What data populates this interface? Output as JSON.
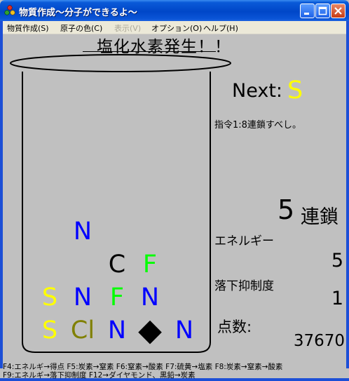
{
  "window": {
    "title": "物質作成～分子ができるよ～"
  },
  "menu": {
    "items": [
      "物質作成(S)",
      "原子の色(C)",
      "表示(V)",
      "オプション(O)",
      "ヘルプ(H)"
    ],
    "disabled_index": 2
  },
  "game": {
    "caption": "塩化水素発生！！",
    "next_label": "Next:",
    "next_atom": "S",
    "order": "指令1:8連鎖すべし。",
    "chain_count": "5",
    "chain_label": "連鎖",
    "energy_label": "エネルギー",
    "energy_value": "5",
    "drop_label": "落下抑制度",
    "drop_value": "1",
    "score_label": "点数:",
    "score_value": "37670",
    "colors": {
      "S": "#ffff00",
      "N": "#0000ff",
      "F": "#00ff00",
      "C": "#000000",
      "Cl": "#808000",
      "diamond": "#000000"
    },
    "atoms": [
      {
        "sym": "N",
        "col": 1,
        "row": 0
      },
      {
        "sym": "C",
        "col": 2,
        "row": 1
      },
      {
        "sym": "F",
        "col": 3,
        "row": 1
      },
      {
        "sym": "S",
        "col": 0,
        "row": 2
      },
      {
        "sym": "N",
        "col": 1,
        "row": 2
      },
      {
        "sym": "F",
        "col": 2,
        "row": 2
      },
      {
        "sym": "N",
        "col": 3,
        "row": 2
      },
      {
        "sym": "S",
        "col": 0,
        "row": 3
      },
      {
        "sym": "Cl",
        "col": 1,
        "row": 3
      },
      {
        "sym": "N",
        "col": 2,
        "row": 3
      },
      {
        "sym": "◆",
        "col": 3,
        "row": 3
      },
      {
        "sym": "N",
        "col": 4,
        "row": 3
      }
    ]
  },
  "help": {
    "line1": "F4:エネルギ→得点 F5:炭素→窒素 F6:窒素→酸素 F7:硫黄→塩素 F8:炭素→窒素→酸素",
    "line2": "F9:エネルギ→落下抑制度 F12→ダイヤモンド、黒鉛→炭素"
  }
}
